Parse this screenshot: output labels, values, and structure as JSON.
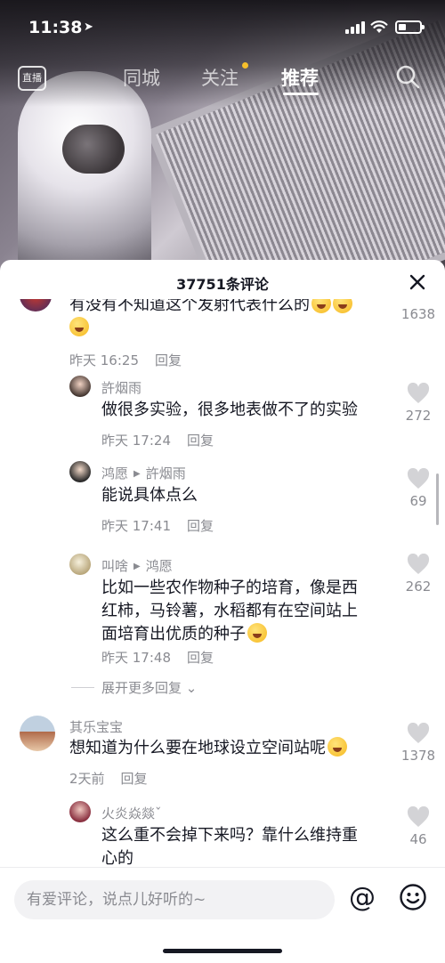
{
  "status_bar": {
    "time": "11:38"
  },
  "top_nav": {
    "live_label": "直播",
    "tabs": [
      {
        "label": "同城"
      },
      {
        "label": "关注"
      },
      {
        "label": "推荐"
      }
    ]
  },
  "sheet": {
    "title": "37751条评论",
    "comments": [
      {
        "text": "有没有不知道这个发射代表什么的",
        "time": "昨天 16:25",
        "reply_label": "回复",
        "likes": "1638"
      },
      {
        "name": "許烟雨",
        "text": "做很多实验，很多地表做不了的实验",
        "time": "昨天 17:24",
        "reply_label": "回复",
        "likes": "272"
      },
      {
        "name": "鸿愿",
        "reply_to": "許烟雨",
        "text": "能说具体点么",
        "time": "昨天 17:41",
        "reply_label": "回复",
        "likes": "69"
      },
      {
        "name": "叫啥",
        "reply_to": "鸿愿",
        "text_line1": "比如一些农作物种子的培育，像是西",
        "text_line2": "红柿，马铃薯，水稻都有在空间站上",
        "text_line3": "面培育出优质的种子",
        "time": "昨天 17:48",
        "reply_label": "回复",
        "likes": "262"
      },
      {
        "name": "其乐宝宝",
        "text": "想知道为什么要在地球设立空间站呢",
        "time": "2天前",
        "reply_label": "回复",
        "likes": "1378"
      },
      {
        "name": "火炎焱燚ˇ",
        "text_line1": "这么重不会掉下来吗？靠什么维持重",
        "text_line2": "心的",
        "likes": "46"
      }
    ],
    "expand_label": "展开更多回复"
  },
  "input_bar": {
    "placeholder": "有爱评论，说点儿好听的~",
    "at_symbol": "@"
  },
  "colors": {
    "text_primary": "#161823",
    "text_secondary": "#8a8b91",
    "indicator_dot": "#f6c02c"
  }
}
